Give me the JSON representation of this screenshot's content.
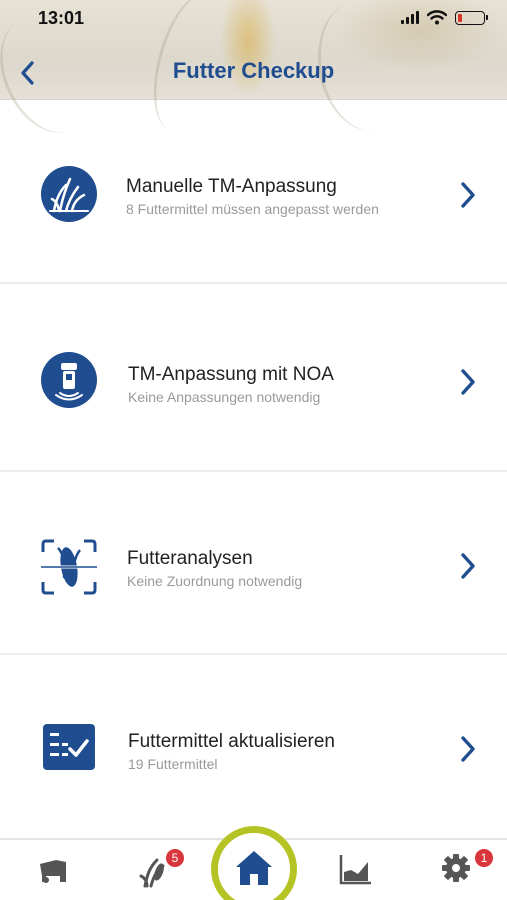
{
  "status_bar": {
    "time": "13:01",
    "icons": [
      "signal-icon",
      "wifi-icon",
      "battery-icon"
    ],
    "battery_level": 0.15
  },
  "nav": {
    "title": "Futter Checkup",
    "back_icon": "chevron-left-icon"
  },
  "items": [
    {
      "title": "Manuelle TM-Anpassung",
      "subtitle": "8 Futtermittel müssen angepasst werden",
      "icon": "grass-icon"
    },
    {
      "title": "TM-Anpassung mit NOA",
      "subtitle": "Keine Anpassungen notwendig",
      "icon": "noa-sensor-icon"
    },
    {
      "title": "Futteranalysen",
      "subtitle": "Keine Zuordnung notwendig",
      "icon": "scan-analysis-icon"
    },
    {
      "title": "Futtermittel aktualisieren",
      "subtitle": "19 Futtermittel",
      "icon": "checklist-icon"
    }
  ],
  "tabbar": {
    "tabs": [
      {
        "icon": "feed-wagon-icon"
      },
      {
        "icon": "feed-plant-icon",
        "badge": "5"
      },
      {
        "icon": "home-icon",
        "active": true
      },
      {
        "icon": "chart-icon"
      },
      {
        "icon": "settings-icon",
        "badge": "1"
      }
    ]
  },
  "colors": {
    "primary": "#1f4d8f",
    "accent_ring": "#b5c424",
    "badge": "#d8353c",
    "subtitle": "#9a9a9a"
  }
}
